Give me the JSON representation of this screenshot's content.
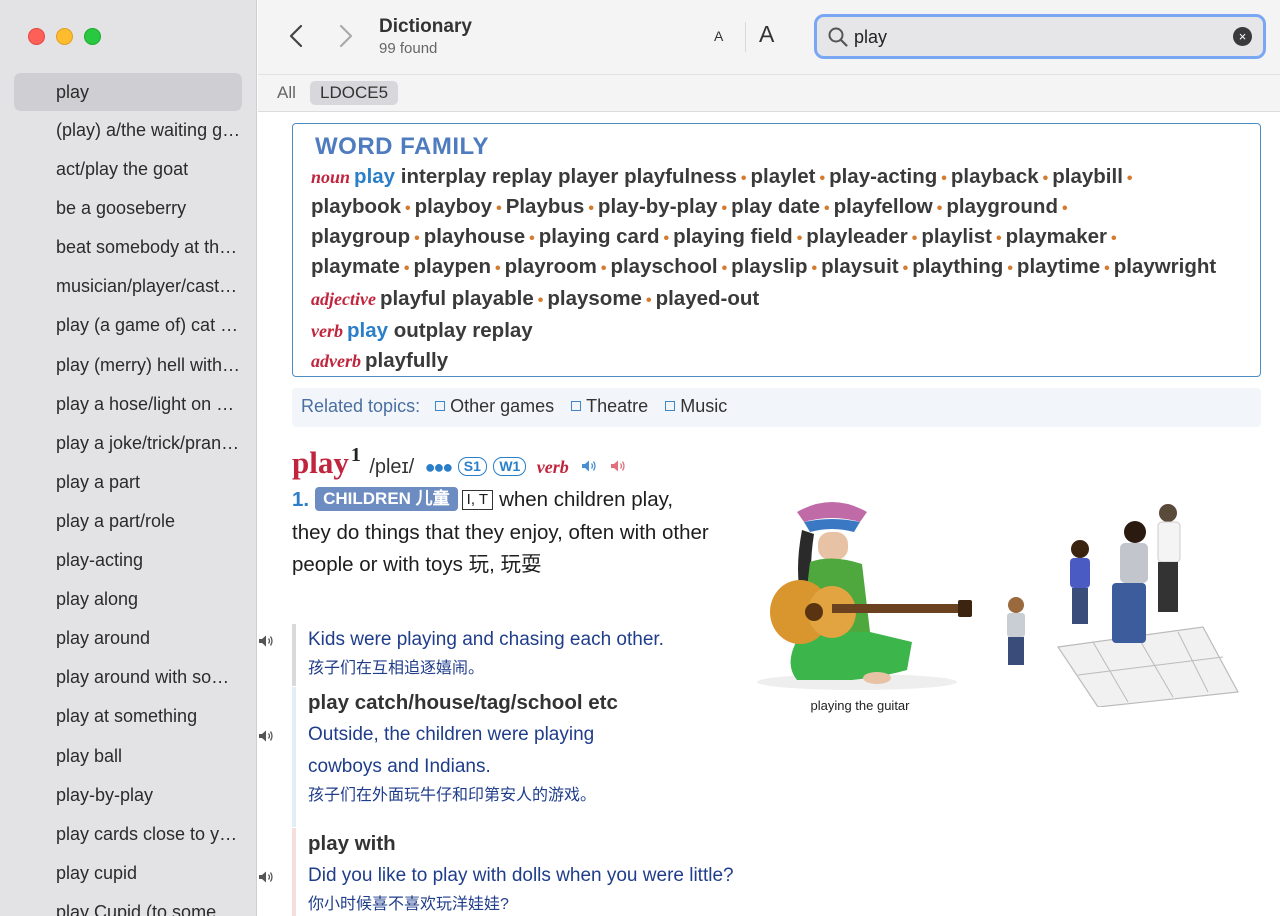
{
  "sidebar": {
    "items": [
      {
        "label": "play"
      },
      {
        "label": "(play) a/the waiting game"
      },
      {
        "label": "act/play the goat"
      },
      {
        "label": "be a gooseberry"
      },
      {
        "label": "beat somebody at their own game"
      },
      {
        "label": "musician/player/cast etc"
      },
      {
        "label": "play (a game of) cat and mouse"
      },
      {
        "label": "play (merry) hell with something"
      },
      {
        "label": "play a hose/light on something"
      },
      {
        "label": "play a joke/trick/prank on"
      },
      {
        "label": "play a part"
      },
      {
        "label": "play a part/role"
      },
      {
        "label": "play-acting"
      },
      {
        "label": "play along"
      },
      {
        "label": "play around"
      },
      {
        "label": "play around with something"
      },
      {
        "label": "play at something"
      },
      {
        "label": "play ball"
      },
      {
        "label": "play-by-play"
      },
      {
        "label": "play cards close to your chest"
      },
      {
        "label": "play cupid"
      },
      {
        "label": "play Cupid (to somebody)"
      }
    ]
  },
  "toolbar": {
    "title": "Dictionary",
    "subtitle": "99 found",
    "font_small": "A",
    "font_large": "A",
    "search_value": "play",
    "clear_glyph": "×"
  },
  "tabs": {
    "all": "All",
    "source": "LDOCE5"
  },
  "word_family": {
    "title": "WORD FAMILY",
    "noun_label": "noun",
    "noun_head": "play",
    "noun_line1_rest": "interplay replay player playfulness",
    "noun_line1_items": [
      "playlet",
      "play-acting",
      "playback",
      "playbill"
    ],
    "noun_line2_items": [
      "playbook",
      "playboy",
      "Playbus",
      "play-by-play",
      "play date",
      "playfellow",
      "playground"
    ],
    "noun_line3_items": [
      "playgroup",
      "playhouse",
      "playing card",
      "playing field",
      "playleader",
      "playlist",
      "playmaker"
    ],
    "noun_line4_items": [
      "playmate",
      "playpen",
      "playroom",
      "playschool",
      "playslip",
      "playsuit",
      "plaything",
      "playtime",
      "playwright"
    ],
    "adjective_label": "adjective",
    "adjective_rest": "playful playable",
    "adjective_items": [
      "playsome",
      "played-out"
    ],
    "verb_label": "verb",
    "verb_head": "play",
    "verb_rest": "outplay replay",
    "adverb_label": "adverb",
    "adverb_rest": "playfully"
  },
  "related": {
    "label": "Related topics:",
    "topics": [
      "Other games",
      "Theatre",
      "Music"
    ]
  },
  "entry": {
    "headword": "play",
    "homograph": "1",
    "pronunciation": "/pleɪ/",
    "frequency_dots": "●●●",
    "badge_s": "S1",
    "badge_w": "W1",
    "pos": "verb",
    "sense_number": "1.",
    "signpost": "CHILDREN 儿童",
    "grammar": "I, T",
    "definition": "when children play, they do things that they enjoy, often with other people or with toys 玩, 玩耍",
    "example1_en": "Kids were playing and chasing each other.",
    "example1_zh": "孩子们在互相追逐嬉闹。",
    "collocation2": "play catch/house/tag/school etc",
    "example2_en": "Outside, the children were playing cowboys and Indians.",
    "example2_zh": "孩子们在外面玩牛仔和印第安人的游戏。",
    "collocation3": "play with",
    "example3_en": "Did you like to play with dolls when you were little?",
    "example3_zh": "你小时候喜不喜欢玩洋娃娃?",
    "image_caption": "playing the guitar"
  },
  "colors": {
    "accent_blue": "#2b7fc9",
    "headword_red": "#c0253d",
    "signpost_bg": "#6d8cc2",
    "search_focus": "#7aa7f4"
  }
}
